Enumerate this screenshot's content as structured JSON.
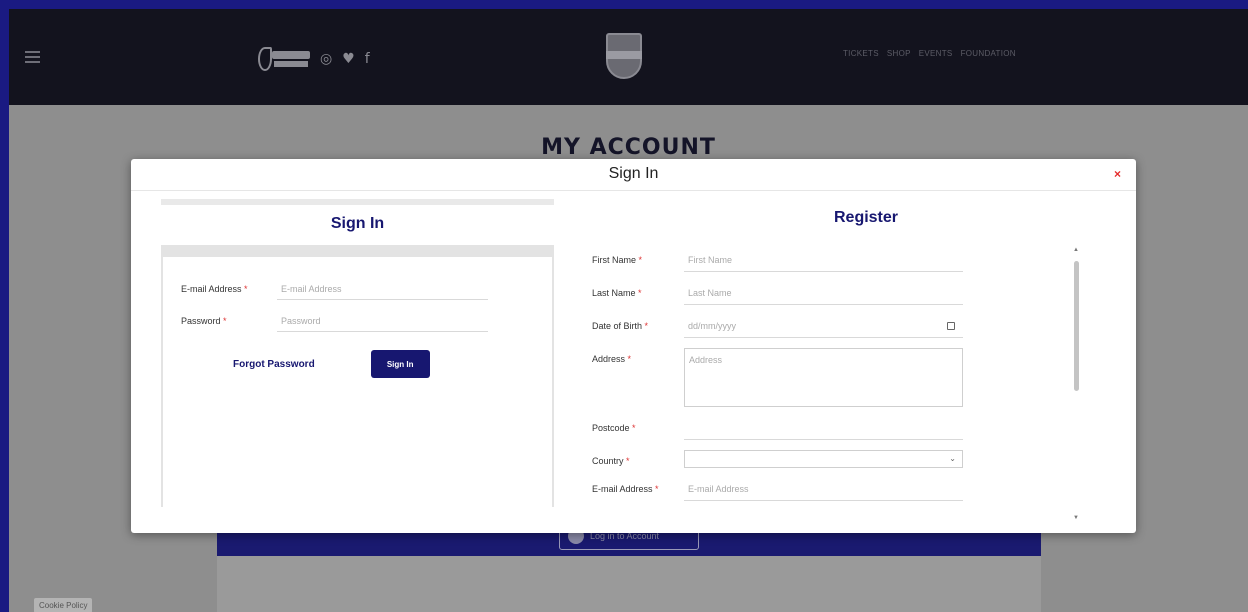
{
  "header": {
    "nav": [
      "TICKETS",
      "SHOP",
      "EVENTS",
      "FOUNDATION"
    ],
    "social_icons": [
      "instagram-icon",
      "twitter-icon",
      "facebook-icon"
    ]
  },
  "page": {
    "title": "MY ACCOUNT",
    "log_in_button": "Log in to Account",
    "cookie_policy": "Cookie Policy"
  },
  "modal": {
    "title": "Sign In",
    "close_symbol": "×",
    "sign_in": {
      "heading": "Sign In",
      "email_label": "E-mail Address",
      "email_placeholder": "E-mail Address",
      "password_label": "Password",
      "password_placeholder": "Password",
      "required_mark": "*",
      "forgot_password": "Forgot Password",
      "submit": "Sign In"
    },
    "register": {
      "heading": "Register",
      "first_name_label": "First Name",
      "first_name_placeholder": "First Name",
      "last_name_label": "Last Name",
      "last_name_placeholder": "Last Name",
      "dob_label": "Date of Birth",
      "dob_placeholder": "dd/mm/yyyy",
      "address_label": "Address",
      "address_placeholder": "Address",
      "postcode_label": "Postcode",
      "country_label": "Country",
      "email_label": "E-mail Address",
      "email_placeholder": "E-mail Address",
      "required_mark": "*"
    }
  },
  "colors": {
    "brand_navy": "#171770",
    "required_red": "#d33333",
    "outer_background": "#1a1a82"
  }
}
